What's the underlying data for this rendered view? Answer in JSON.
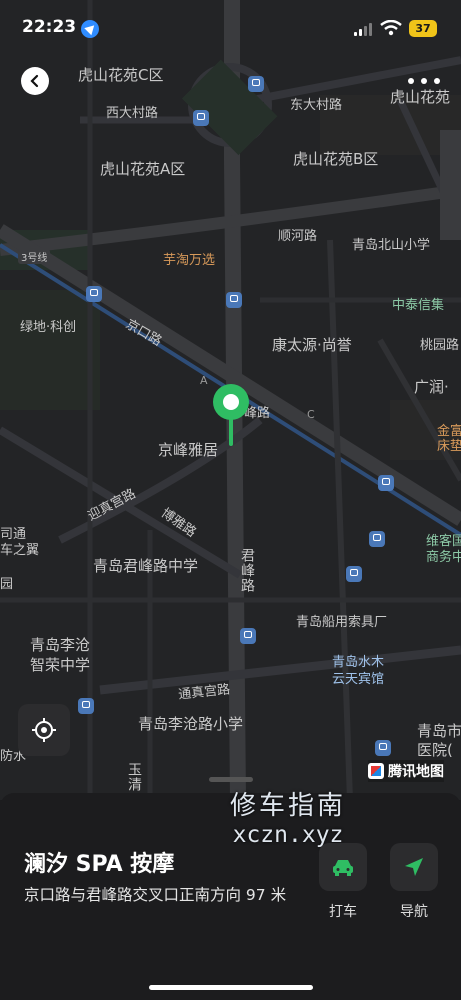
{
  "status_bar": {
    "time": "22:23",
    "battery": "37"
  },
  "map": {
    "labels": {
      "huhshan_c": "虎山花苑C区",
      "huhshan_a": "虎山花苑A区",
      "huhshan_b": "虎山花苑B区",
      "huhshan_top": "虎山花苑",
      "xidacun": "西大村路",
      "dongdacun": "东大村路",
      "shunhe": "顺河路",
      "jingkou": "京口路",
      "kangtaiyuan": "康太源·尚誉",
      "jingfengyaju": "京峰雅居",
      "fenglu": "峰路",
      "yingzhen": "迎真宫路",
      "boya": "博雅路",
      "junfeng": "君峰路",
      "junfeng_school": "青岛君峰路中学",
      "chuanyong": "青岛船用索具厂",
      "licang_zhirong_1": "青岛李沧",
      "licang_zhirong_2": "智荣中学",
      "tongzhen": "通真宫路",
      "licang_school": "青岛李沧路小学",
      "yuqing": "玉清",
      "shuimu_1": "青岛水木",
      "shuimu_2": "云天宾馆",
      "qingdao_city_1": "青岛市",
      "qingdao_city_2": "医院(",
      "licang_edge": "防水",
      "yutao": "芋淘万选",
      "beishan_school": "青岛北山小学",
      "zhongtai": "中泰信集",
      "taoyuan": "桃园路",
      "guangrun": "广润·",
      "jinfu_1": "金富",
      "jinfu_2": "床垫",
      "weijia_1": "维客国",
      "weijia_2": "商务中",
      "lvdi": "绿地·科创",
      "situng_1": "司通",
      "situng_2": "车之翼",
      "yuan": "园",
      "road_3": "3号线",
      "marker_a": "A",
      "marker_c": "C"
    }
  },
  "watermark": {
    "line1": "修车指南",
    "line2": "xczn.xyz"
  },
  "map_logo": "腾讯地图",
  "place": {
    "name": "澜汐 SPA 按摩",
    "address": "京口路与君峰路交叉口正南方向 97 米"
  },
  "actions": {
    "taxi": "打车",
    "navigate": "导航"
  },
  "colors": {
    "accent_green": "#2fbd63",
    "map_bg": "#232426",
    "sheet_bg": "#1c1c1e"
  }
}
